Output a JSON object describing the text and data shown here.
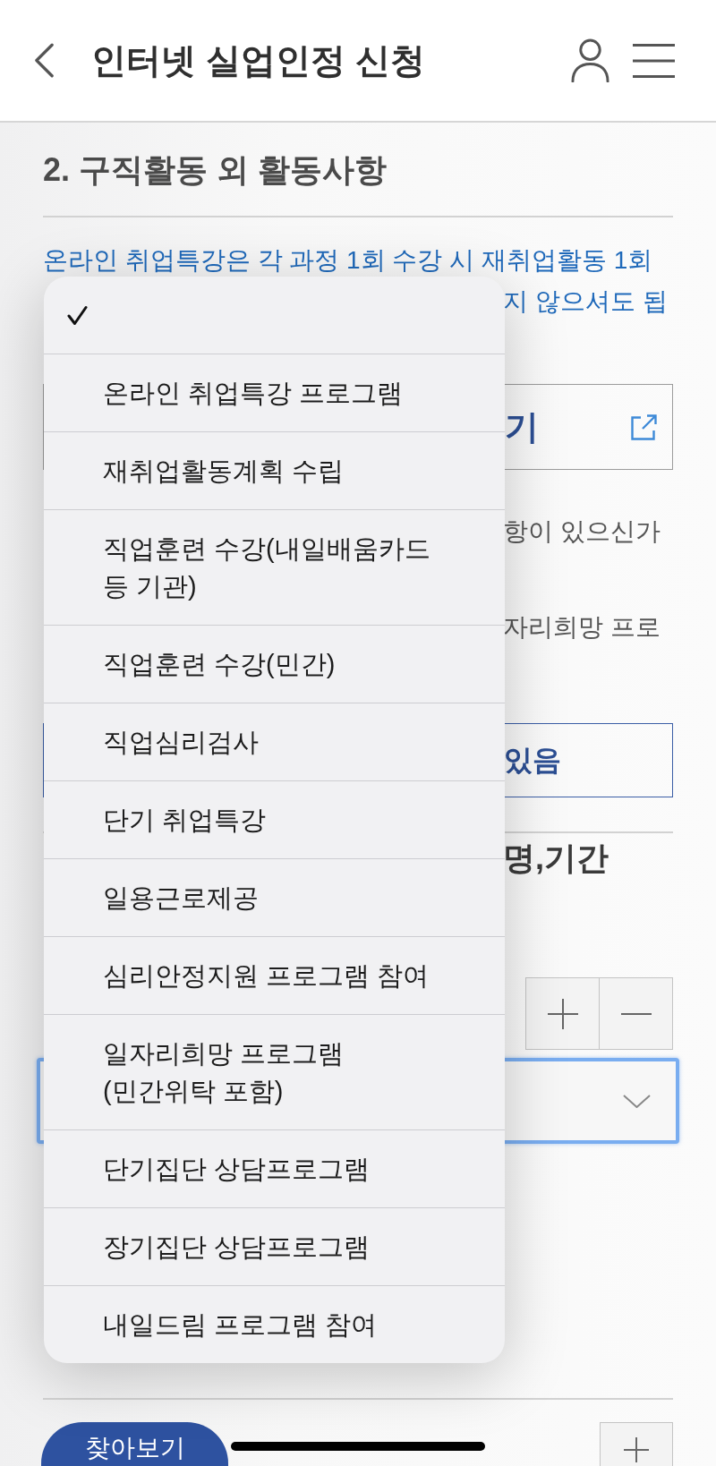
{
  "header": {
    "title": "인터넷 실업인정 신청"
  },
  "section": {
    "title": "2. 구직활동 외 활동사항",
    "notice_line": "온라인 취업특강은 각 과정 1회 수강 시 재취업활동 1회",
    "notice_fragment": "지 않으셔도 됩"
  },
  "link_button": {
    "label": "기"
  },
  "question_fragments": [
    "항이 있으신가",
    "자리희망 프로"
  ],
  "answer_button": {
    "label": "있음",
    "selected": true
  },
  "heading_fragment": "명,기간",
  "select_field": {
    "focused": true
  },
  "find_button": {
    "label": "찾아보기"
  },
  "menu": {
    "options": [
      {
        "selected": true
      },
      {
        "label": "온라인 취업특강 프로그램",
        "selected": false
      },
      {
        "label": "재취업활동계획 수립",
        "selected": false
      },
      {
        "label": "직업훈련 수강(내일배움카드\n등 기관)",
        "selected": false
      },
      {
        "label": "직업훈련 수강(민간)",
        "selected": false
      },
      {
        "label": "직업심리검사",
        "selected": false
      },
      {
        "label": "단기 취업특강",
        "selected": false
      },
      {
        "label": "일용근로제공",
        "selected": false
      },
      {
        "label": "심리안정지원 프로그램 참여",
        "selected": false
      },
      {
        "label": "일자리희망 프로그램\n(민간위탁 포함)",
        "selected": false
      },
      {
        "label": "단기집단 상담프로그램",
        "selected": false
      },
      {
        "label": "장기집단 상담프로그램",
        "selected": false
      },
      {
        "label": "내일드림 프로그램 참여",
        "selected": false
      }
    ]
  }
}
